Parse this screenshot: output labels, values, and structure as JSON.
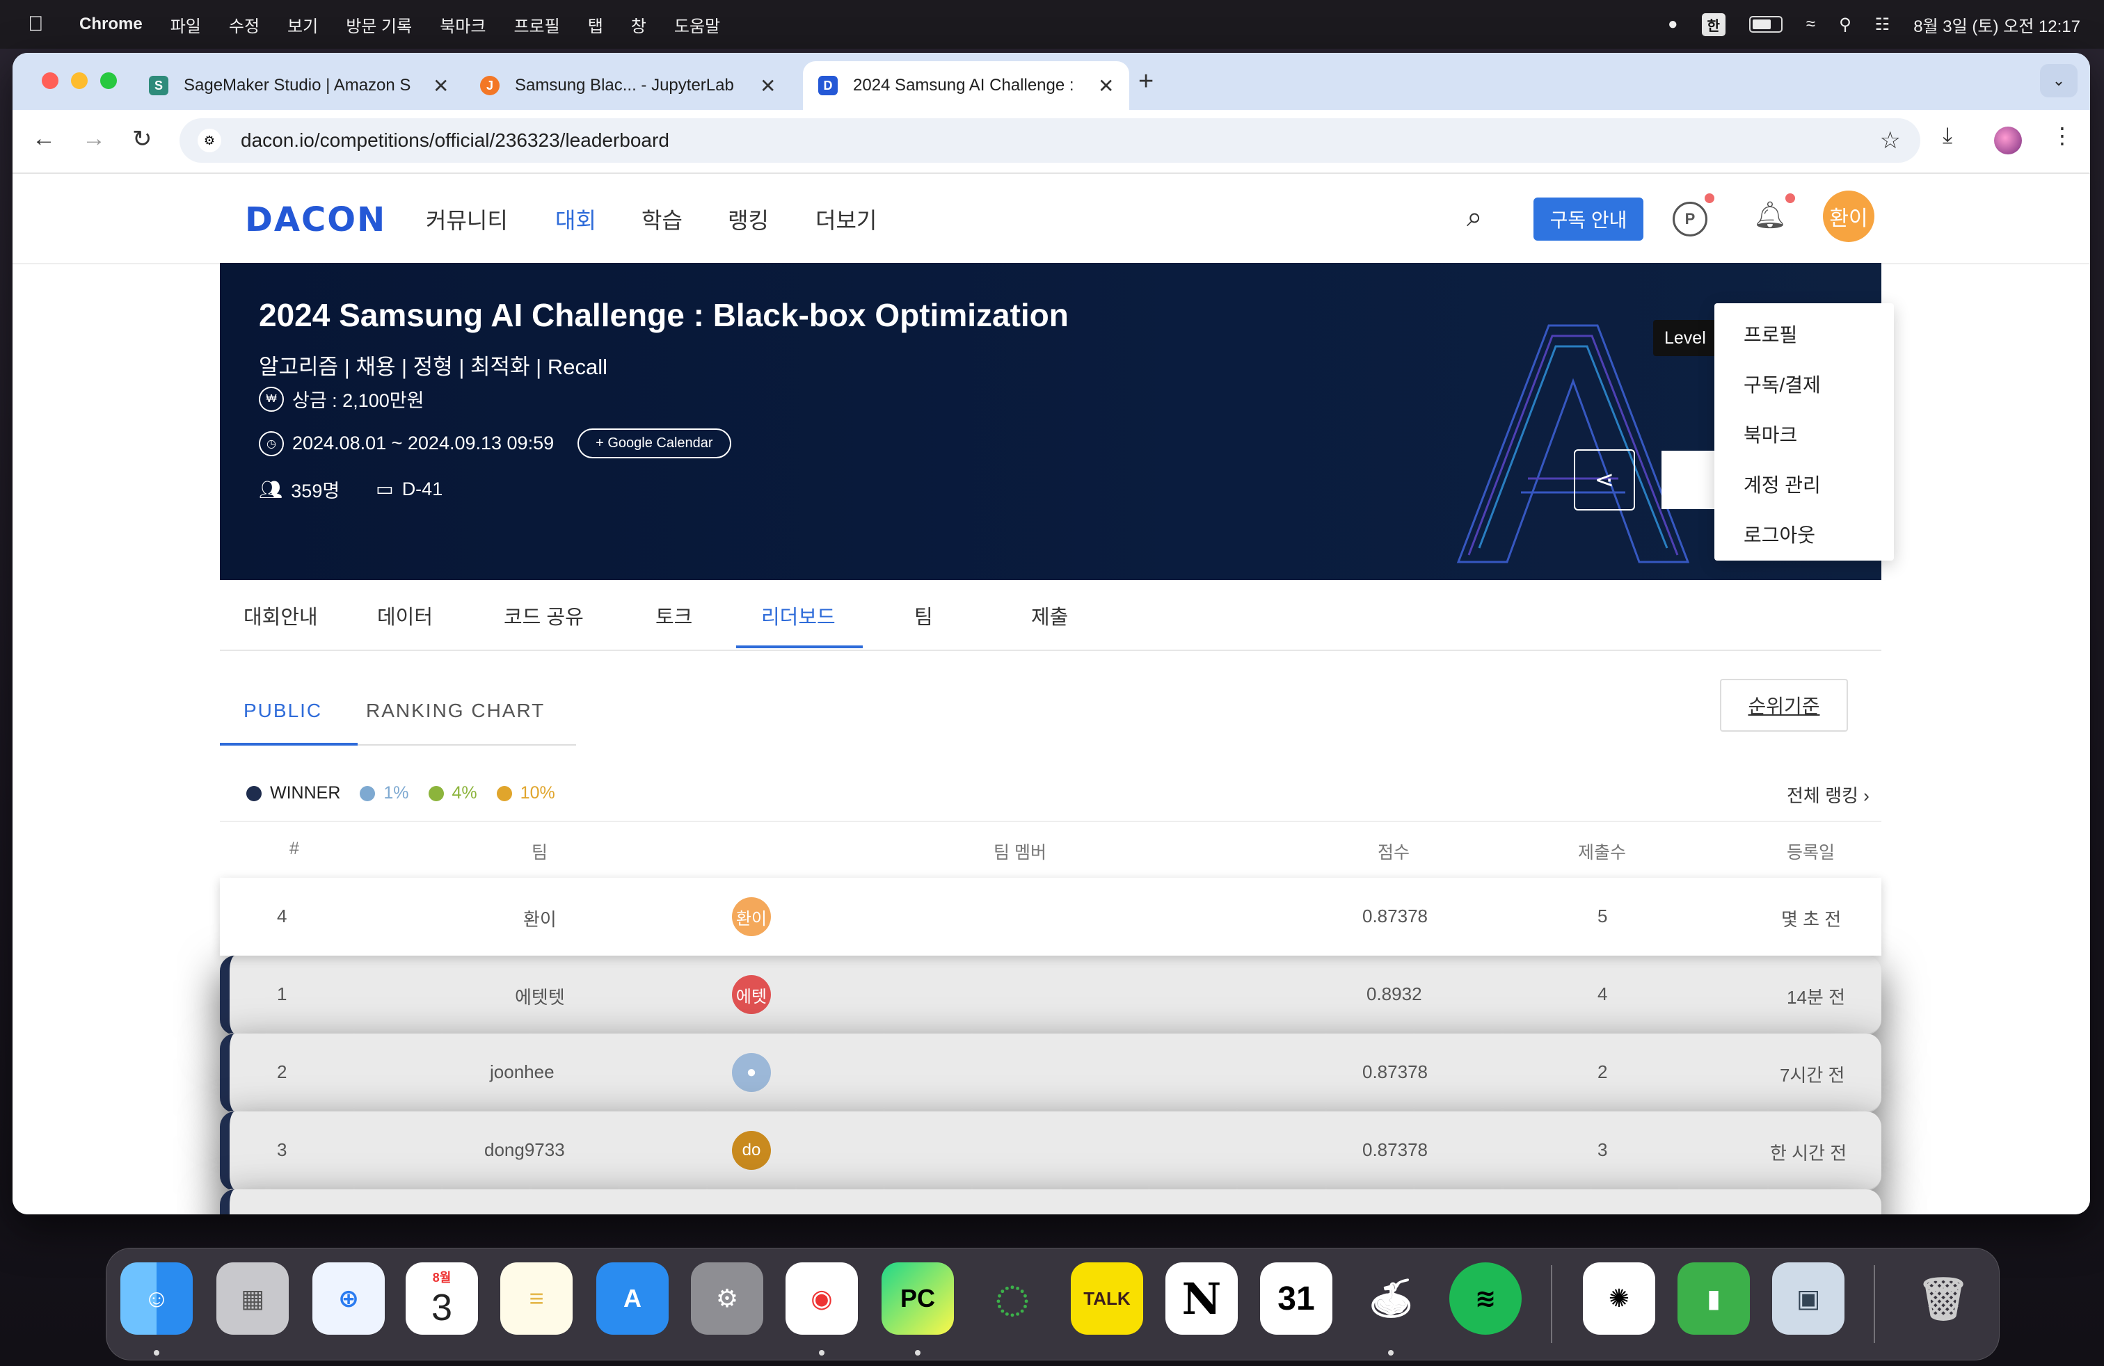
{
  "menubar": {
    "app": "Chrome",
    "items": [
      "파일",
      "수정",
      "보기",
      "방문 기록",
      "북마크",
      "프로필",
      "탭",
      "창",
      "도움말"
    ],
    "input_source": "한",
    "clock": "8월 3일 (토) 오전 12:17"
  },
  "browser": {
    "tabs": [
      {
        "title": "SageMaker Studio | Amazon S"
      },
      {
        "title": "Samsung Blac... - JupyterLab"
      },
      {
        "title": "2024 Samsung AI Challenge :"
      }
    ],
    "url": "dacon.io/competitions/official/236323/leaderboard"
  },
  "site": {
    "logo": "DACON",
    "nav": [
      "커뮤니티",
      "대회",
      "학습",
      "랭킹",
      "더보기"
    ],
    "subscribe_label": "구독 안내",
    "user_initial": "환이",
    "tooltip": "Level",
    "dropdown": [
      "프로필",
      "구독/결제",
      "북마크",
      "계정 관리",
      "로그아웃"
    ]
  },
  "hero": {
    "title": "2024 Samsung AI Challenge : Black-box Optimization",
    "tags": "알고리즘 | 채용 | 정형 | 최적화 | Recall",
    "prize": "상금 : 2,100만원",
    "period": "2024.08.01 ~ 2024.09.13 09:59",
    "gcal_label": "+ Google Calendar",
    "participants": "359명",
    "dday": "D-41"
  },
  "comp_tabs": [
    "대회안내",
    "데이터",
    "코드 공유",
    "토크",
    "리더보드",
    "팀",
    "제출"
  ],
  "sub_tabs": [
    "PUBLIC",
    "RANKING CHART"
  ],
  "rank_criteria_label": "순위기준",
  "legend": [
    {
      "label": "WINNER",
      "color": "#1f2d4e"
    },
    {
      "label": "1%",
      "color": "#7ea9d1"
    },
    {
      "label": "4%",
      "color": "#8cb43c"
    },
    {
      "label": "10%",
      "color": "#e0a52c"
    }
  ],
  "all_ranking_label": "전체 랭킹 ›",
  "table": {
    "headers": [
      "#",
      "팀",
      "팀 멤버",
      "점수",
      "제출수",
      "등록일"
    ],
    "rows": [
      {
        "rank": "4",
        "team": "환이",
        "member": "환이",
        "member_color": "#f4a85a",
        "score": "0.87378",
        "subs": "5",
        "date": "몇 초 전"
      },
      {
        "rank": "1",
        "team": "에텟텟",
        "member": "에텟",
        "member_color": "#e05252",
        "score": "0.8932",
        "subs": "4",
        "date": "14분 전"
      },
      {
        "rank": "2",
        "team": "joonhee",
        "member": "",
        "member_color": "#9cb8d8",
        "score": "0.87378",
        "subs": "2",
        "date": "7시간 전"
      },
      {
        "rank": "3",
        "team": "dong9733",
        "member": "do",
        "member_color": "#c98a1e",
        "score": "0.87378",
        "subs": "3",
        "date": "한 시간 전"
      }
    ]
  },
  "dock": {
    "calendar_month": "8월",
    "calendar_day": "3"
  }
}
